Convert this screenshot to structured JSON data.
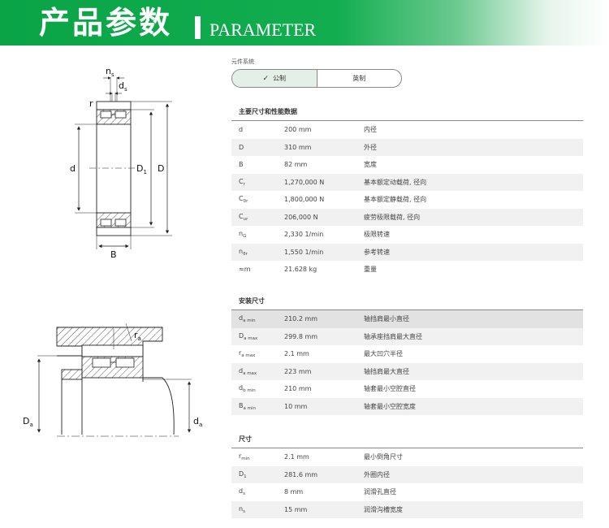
{
  "banner": {
    "title": "产品参数",
    "subtitle": "PARAMETER"
  },
  "unit_system": {
    "label": "元件系统",
    "options": [
      {
        "label": "公制",
        "active": true
      },
      {
        "label": "英制",
        "active": false
      }
    ]
  },
  "sections": [
    {
      "title": "主要尺寸和性能数据",
      "rows": [
        {
          "sym": "d",
          "sub": "",
          "value": "200 mm",
          "desc": "内径"
        },
        {
          "sym": "D",
          "sub": "",
          "value": "310 mm",
          "desc": "外径"
        },
        {
          "sym": "B",
          "sub": "",
          "value": "82 mm",
          "desc": "宽度"
        },
        {
          "sym": "C",
          "sub": "r",
          "value": "1,270,000 N",
          "desc": "基本额定动载荷, 径向"
        },
        {
          "sym": "C",
          "sub": "0r",
          "value": "1,800,000 N",
          "desc": "基本额定静载荷, 径向"
        },
        {
          "sym": "C",
          "sub": "ur",
          "value": "206,000 N",
          "desc": "疲劳极限载荷, 径向"
        },
        {
          "sym": "n",
          "sub": "G",
          "value": "2,330 1/min",
          "desc": "极限转速"
        },
        {
          "sym": "n",
          "sub": "ϑr",
          "value": "1,550 1/min",
          "desc": "参考转速"
        },
        {
          "sym": "≈m",
          "sub": "",
          "value": "21.628 kg",
          "desc": "重量"
        }
      ]
    },
    {
      "title": "安装尺寸",
      "rows": [
        {
          "sym": "d",
          "sub": "a min",
          "value": "210.2 mm",
          "desc": "轴挡肩最小直径"
        },
        {
          "sym": "D",
          "sub": "a max",
          "value": "299.8 mm",
          "desc": "轴承座挡肩最大直径"
        },
        {
          "sym": "r",
          "sub": "a max",
          "value": "2.1 mm",
          "desc": "最大凹穴半径"
        },
        {
          "sym": "d",
          "sub": "a max",
          "value": "223 mm",
          "desc": "轴挡肩最大直径"
        },
        {
          "sym": "d",
          "sub": "b min",
          "value": "210 mm",
          "desc": "轴套最小空腔直径"
        },
        {
          "sym": "B",
          "sub": "a min",
          "value": "10 mm",
          "desc": "轴套最小空腔宽度"
        }
      ]
    },
    {
      "title": "尺寸",
      "rows": [
        {
          "sym": "r",
          "sub": "min",
          "value": "2.1 mm",
          "desc": "最小倒角尺寸"
        },
        {
          "sym": "D",
          "sub": "1",
          "value": "281.6 mm",
          "desc": "外圈内径"
        },
        {
          "sym": "d",
          "sub": "s",
          "value": "8 mm",
          "desc": "润滑孔直径"
        },
        {
          "sym": "n",
          "sub": "s",
          "value": "15 mm",
          "desc": "润滑沟槽宽度"
        }
      ]
    }
  ],
  "drawing_top": {
    "labels": {
      "ns": "n",
      "ns_sub": "s",
      "ds": "d",
      "ds_sub": "s",
      "r": "r",
      "d": "d",
      "D1": "D",
      "D1_sub": "1",
      "D": "D",
      "B": "B"
    }
  },
  "drawing_bottom": {
    "labels": {
      "ra": "r",
      "ra_sub": "a",
      "Da": "D",
      "Da_sub": "a",
      "da": "d",
      "da_sub": "a"
    }
  }
}
